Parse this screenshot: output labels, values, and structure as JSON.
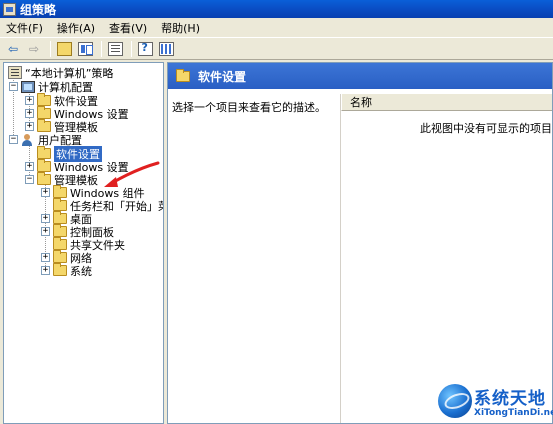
{
  "window": {
    "title": "组策略"
  },
  "menu": [
    "文件(F)",
    "操作(A)",
    "查看(V)",
    "帮助(H)"
  ],
  "tree": {
    "root": "“本地计算机”策略",
    "computer_config": "计算机配置",
    "cc_software": "软件设置",
    "cc_windows": "Windows 设置",
    "cc_admin": "管理模板",
    "user_config": "用户配置",
    "uc_software": "软件设置",
    "uc_windows": "Windows 设置",
    "uc_admin": "管理模板",
    "admin_children": [
      "Windows 组件",
      "任务栏和「开始」菜",
      "桌面",
      "控制面板",
      "共享文件夹",
      "网络",
      "系统"
    ]
  },
  "right": {
    "header": "软件设置",
    "description": "选择一个项目来查看它的描述。",
    "column_name": "名称",
    "empty_message": "此视图中没有可显示的项目"
  },
  "watermark": {
    "title": "系统天地",
    "url": "XiTongTianDi.net"
  },
  "colors": {
    "selection": "#316ac5",
    "header_blue": "#2a5fc4",
    "arrow": "#e02020"
  }
}
